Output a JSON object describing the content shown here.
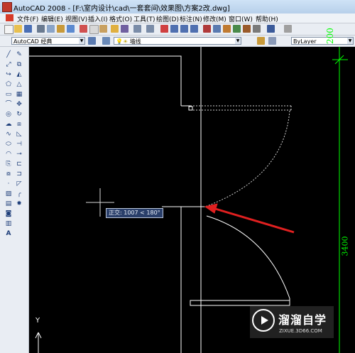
{
  "window": {
    "title": "AutoCAD 2008 - [F:\\室内设计\\cad\\一套套间\\效果图\\方案2改.dwg]"
  },
  "menu": {
    "items": [
      "文件(F)",
      "编辑(E)",
      "视图(V)",
      "插入(I)",
      "格式(O)",
      "工具(T)",
      "绘图(D)",
      "标注(N)",
      "修改(M)",
      "窗口(W)",
      "帮助(H)"
    ]
  },
  "toolbar2": {
    "workspace": "AutoCAD 经典",
    "layer": "墙线",
    "color": "ByLayer"
  },
  "canvas": {
    "tooltip": "正交: 1007 < 180°",
    "dim_top": "200",
    "dim_mid": "3400",
    "ucs_y": "Y"
  },
  "watermark": {
    "name": "溜溜自学",
    "url": "ZIXUE.3D66.COM"
  },
  "colors": {
    "dimension": "#00ff00",
    "arrow": "#e02020",
    "tooltip_bg": "#2a3f6a"
  }
}
